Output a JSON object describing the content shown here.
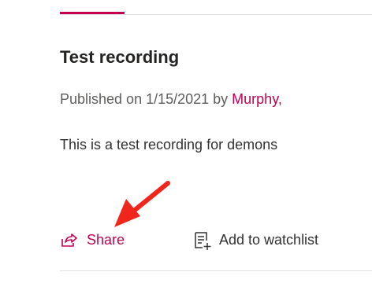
{
  "recording": {
    "title": "Test recording",
    "published_prefix": "Published on 1/15/2021 by ",
    "author": "Murphy,",
    "description": "This is a test recording for demons"
  },
  "actions": {
    "share_label": "Share",
    "watchlist_label": "Add to watchlist"
  },
  "colors": {
    "accent": "#c30052",
    "annotation_arrow": "#f0261c"
  },
  "icons": {
    "share": "share-icon",
    "watchlist": "add-to-watchlist-icon",
    "annotation": "red-arrow-icon"
  }
}
